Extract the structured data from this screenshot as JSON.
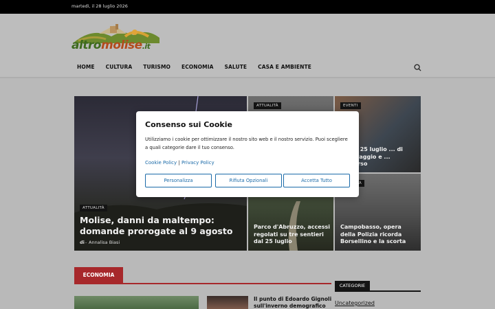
{
  "topbar": {
    "date": "martedì, il 28 luglio 2026"
  },
  "logo": {
    "part1": "altro",
    "part2": "molise",
    "part3": ".it"
  },
  "nav": [
    "HOME",
    "CULTURA",
    "TURISMO",
    "ECONOMIA",
    "SALUTE",
    "CASA E AMBIENTE"
  ],
  "hero": {
    "main": {
      "category": "ATTUALITÀ",
      "title": "Molise, danni da maltempo: domande prorogate al 9 agosto",
      "by": "di",
      "author": "Annalisa Biasi"
    },
    "t2": {
      "category": "ATTUALITÀ"
    },
    "t3": {
      "category": "EVENTI",
      "title": "...li, il 25 luglio ... di salvataggio e ... soccorso"
    },
    "t4": {
      "title": "Parco d'Abruzzo, accessi regolati su tre sentieri dal 25 luglio"
    },
    "t5": {
      "category": "...UALITÀ",
      "title": "Campobasso, opera della Polizia ricorda Borsellino e la scorta"
    }
  },
  "section": {
    "label": "ECONOMIA"
  },
  "article": {
    "title": "Il punto di Edoardo Gignoli sull'inverno demografico in"
  },
  "sidebar": {
    "heading": "CATEGORIE",
    "link": "Uncategorized"
  },
  "cookie": {
    "title": "Consenso sui Cookie",
    "text": "Utilizziamo i cookie per ottimizzare il nostro sito web e il nostro servizio. Puoi scegliere a quali categorie dare il tuo consenso.",
    "policy": "Cookie Policy",
    "sep": "|",
    "privacy": "Privacy Policy",
    "btn_customize": "Personalizza",
    "btn_reject": "Rifiuta Opzionali",
    "btn_accept": "Accetta Tutto"
  },
  "colors": {
    "accent": "#a7282b",
    "link": "#1a6aa8"
  }
}
